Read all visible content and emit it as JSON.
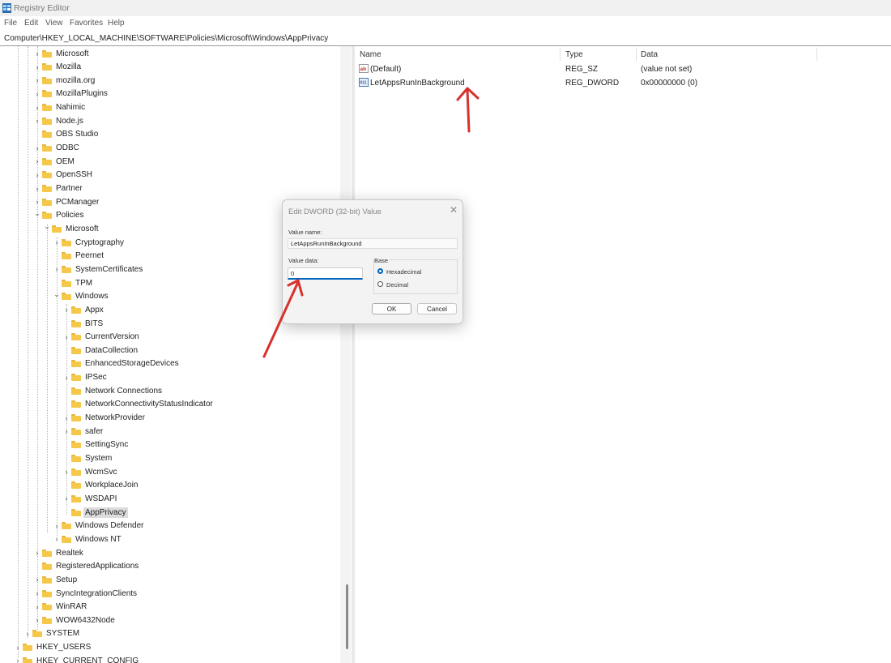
{
  "window": {
    "title": "Registry Editor"
  },
  "menu": [
    "File",
    "Edit",
    "View",
    "Favorites",
    "Help"
  ],
  "address": "Computer\\HKEY_LOCAL_MACHINE\\SOFTWARE\\Policies\\Microsoft\\Windows\\AppPrivacy",
  "tree": [
    {
      "label": "Microsoft",
      "level": 1,
      "expander": "collapsed"
    },
    {
      "label": "Mozilla",
      "level": 1,
      "expander": "collapsed"
    },
    {
      "label": "mozilla.org",
      "level": 1,
      "expander": "collapsed"
    },
    {
      "label": "MozillaPlugins",
      "level": 1,
      "expander": "collapsed"
    },
    {
      "label": "Nahimic",
      "level": 1,
      "expander": "collapsed"
    },
    {
      "label": "Node.js",
      "level": 1,
      "expander": "collapsed"
    },
    {
      "label": "OBS Studio",
      "level": 1,
      "expander": "none"
    },
    {
      "label": "ODBC",
      "level": 1,
      "expander": "collapsed"
    },
    {
      "label": "OEM",
      "level": 1,
      "expander": "collapsed"
    },
    {
      "label": "OpenSSH",
      "level": 1,
      "expander": "collapsed"
    },
    {
      "label": "Partner",
      "level": 1,
      "expander": "collapsed"
    },
    {
      "label": "PCManager",
      "level": 1,
      "expander": "collapsed"
    },
    {
      "label": "Policies",
      "level": 1,
      "expander": "expanded"
    },
    {
      "label": "Microsoft",
      "level": 2,
      "expander": "expanded"
    },
    {
      "label": "Cryptography",
      "level": 3,
      "expander": "collapsed"
    },
    {
      "label": "Peernet",
      "level": 3,
      "expander": "none"
    },
    {
      "label": "SystemCertificates",
      "level": 3,
      "expander": "collapsed"
    },
    {
      "label": "TPM",
      "level": 3,
      "expander": "none"
    },
    {
      "label": "Windows",
      "level": 3,
      "expander": "expanded"
    },
    {
      "label": "Appx",
      "level": 4,
      "expander": "collapsed"
    },
    {
      "label": "BITS",
      "level": 4,
      "expander": "none"
    },
    {
      "label": "CurrentVersion",
      "level": 4,
      "expander": "collapsed"
    },
    {
      "label": "DataCollection",
      "level": 4,
      "expander": "none"
    },
    {
      "label": "EnhancedStorageDevices",
      "level": 4,
      "expander": "none"
    },
    {
      "label": "IPSec",
      "level": 4,
      "expander": "collapsed"
    },
    {
      "label": "Network Connections",
      "level": 4,
      "expander": "none"
    },
    {
      "label": "NetworkConnectivityStatusIndicator",
      "level": 4,
      "expander": "none"
    },
    {
      "label": "NetworkProvider",
      "level": 4,
      "expander": "collapsed"
    },
    {
      "label": "safer",
      "level": 4,
      "expander": "collapsed"
    },
    {
      "label": "SettingSync",
      "level": 4,
      "expander": "none"
    },
    {
      "label": "System",
      "level": 4,
      "expander": "none"
    },
    {
      "label": "WcmSvc",
      "level": 4,
      "expander": "collapsed"
    },
    {
      "label": "WorkplaceJoin",
      "level": 4,
      "expander": "none"
    },
    {
      "label": "WSDAPI",
      "level": 4,
      "expander": "collapsed"
    },
    {
      "label": "AppPrivacy",
      "level": 4,
      "expander": "none",
      "selected": true
    },
    {
      "label": "Windows Defender",
      "level": 3,
      "expander": "collapsed"
    },
    {
      "label": "Windows NT",
      "level": 3,
      "expander": "collapsed"
    },
    {
      "label": "Realtek",
      "level": 1,
      "expander": "collapsed"
    },
    {
      "label": "RegisteredApplications",
      "level": 1,
      "expander": "none"
    },
    {
      "label": "Setup",
      "level": 1,
      "expander": "collapsed"
    },
    {
      "label": "SyncIntegrationClients",
      "level": 1,
      "expander": "collapsed"
    },
    {
      "label": "WinRAR",
      "level": 1,
      "expander": "collapsed"
    },
    {
      "label": "WOW6432Node",
      "level": 1,
      "expander": "collapsed"
    },
    {
      "label": "SYSTEM",
      "level": 0,
      "expander": "collapsed"
    },
    {
      "label": "HKEY_USERS",
      "level": -1,
      "expander": "collapsed"
    },
    {
      "label": "HKEY_CURRENT_CONFIG",
      "level": -1,
      "expander": "collapsed"
    }
  ],
  "list": {
    "headers": {
      "name": "Name",
      "type": "Type",
      "data": "Data"
    },
    "rows": [
      {
        "name": "(Default)",
        "type": "REG_SZ",
        "data": "(value not set)",
        "icon": "string-value-icon"
      },
      {
        "name": "LetAppsRunInBackground",
        "type": "REG_DWORD",
        "data": "0x00000000 (0)",
        "icon": "dword-value-icon"
      }
    ]
  },
  "dialog": {
    "title": "Edit DWORD (32-bit) Value",
    "value_name_label": "Value name:",
    "value_name": "LetAppsRunInBackground",
    "value_data_label": "Value data:",
    "value_data": "0",
    "base_label": "Base",
    "base_options": [
      "Hexadecimal",
      "Decimal"
    ],
    "base_selected": "Hexadecimal",
    "ok_label": "OK",
    "cancel_label": "Cancel",
    "close_glyph": "✕"
  },
  "colors": {
    "folder": "#f6c84a",
    "accent": "#0067c0",
    "annotation_arrow": "#d9302c"
  }
}
